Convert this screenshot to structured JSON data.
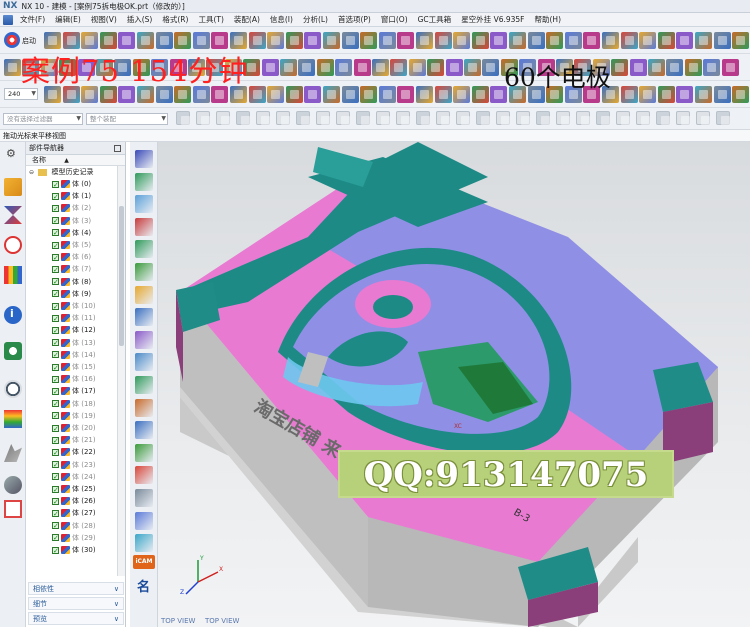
{
  "window": {
    "logo": "NX",
    "title": "NX 10 - 建模 - [案例75拆电极OK.prt（修改的）]"
  },
  "menu": [
    "文件(F)",
    "编辑(E)",
    "视图(V)",
    "插入(S)",
    "格式(R)",
    "工具(T)",
    "装配(A)",
    "信息(I)",
    "分析(L)",
    "首选项(P)",
    "窗口(O)",
    "GC工具箱",
    "星空外挂 V6.935F",
    "帮助(H)"
  ],
  "toolbar": {
    "start_label": "启动",
    "zoom_value": "240"
  },
  "overlay": {
    "case_text": "案例75  154分钟",
    "electrode_text": "60个电极"
  },
  "filters": {
    "selection_filter": "没有选择过滤器",
    "assembly_scope": "整个装配"
  },
  "status": {
    "hint": "拖动光标来平移视图"
  },
  "navigator": {
    "title": "部件导航器",
    "column_name": "名称",
    "root": "模型历史记录",
    "items": [
      {
        "label": "体 (0)",
        "dim": false
      },
      {
        "label": "体 (1)",
        "dim": false
      },
      {
        "label": "体 (2)",
        "dim": true
      },
      {
        "label": "体 (3)",
        "dim": true
      },
      {
        "label": "体 (4)",
        "dim": false
      },
      {
        "label": "体 (5)",
        "dim": true
      },
      {
        "label": "体 (6)",
        "dim": true
      },
      {
        "label": "体 (7)",
        "dim": true
      },
      {
        "label": "体 (8)",
        "dim": false
      },
      {
        "label": "体 (9)",
        "dim": false
      },
      {
        "label": "体 (10)",
        "dim": true
      },
      {
        "label": "体 (11)",
        "dim": true
      },
      {
        "label": "体 (12)",
        "dim": false
      },
      {
        "label": "体 (13)",
        "dim": true
      },
      {
        "label": "体 (14)",
        "dim": true
      },
      {
        "label": "体 (15)",
        "dim": true
      },
      {
        "label": "体 (16)",
        "dim": true
      },
      {
        "label": "体 (17)",
        "dim": false
      },
      {
        "label": "体 (18)",
        "dim": true
      },
      {
        "label": "体 (19)",
        "dim": true
      },
      {
        "label": "体 (20)",
        "dim": true
      },
      {
        "label": "体 (21)",
        "dim": true
      },
      {
        "label": "体 (22)",
        "dim": false
      },
      {
        "label": "体 (23)",
        "dim": true
      },
      {
        "label": "体 (24)",
        "dim": true
      },
      {
        "label": "体 (25)",
        "dim": false
      },
      {
        "label": "体 (26)",
        "dim": false
      },
      {
        "label": "体 (27)",
        "dim": false
      },
      {
        "label": "体 (28)",
        "dim": true
      },
      {
        "label": "体 (29)",
        "dim": true
      },
      {
        "label": "体 (30)",
        "dim": false
      }
    ],
    "panels": [
      "相依性",
      "细节",
      "预览"
    ]
  },
  "side_tools": {
    "icam_label": "iCAM",
    "ming_label": "名"
  },
  "viewport": {
    "engraving_text": "淘宝店铺 来 工作室",
    "tag_label": "B-3",
    "view_label": "TOP VIEW",
    "axis_x": "X",
    "axis_y": "Y",
    "axis_z": "Z",
    "xc_label": "XC",
    "qq_text": "QQ:913147075"
  },
  "colors": {
    "teal": "#1d8a86",
    "pink": "#e87ad2",
    "violet": "#8f8fe6",
    "gray": "#bdbdbd",
    "accent_red": "#ff2020"
  }
}
